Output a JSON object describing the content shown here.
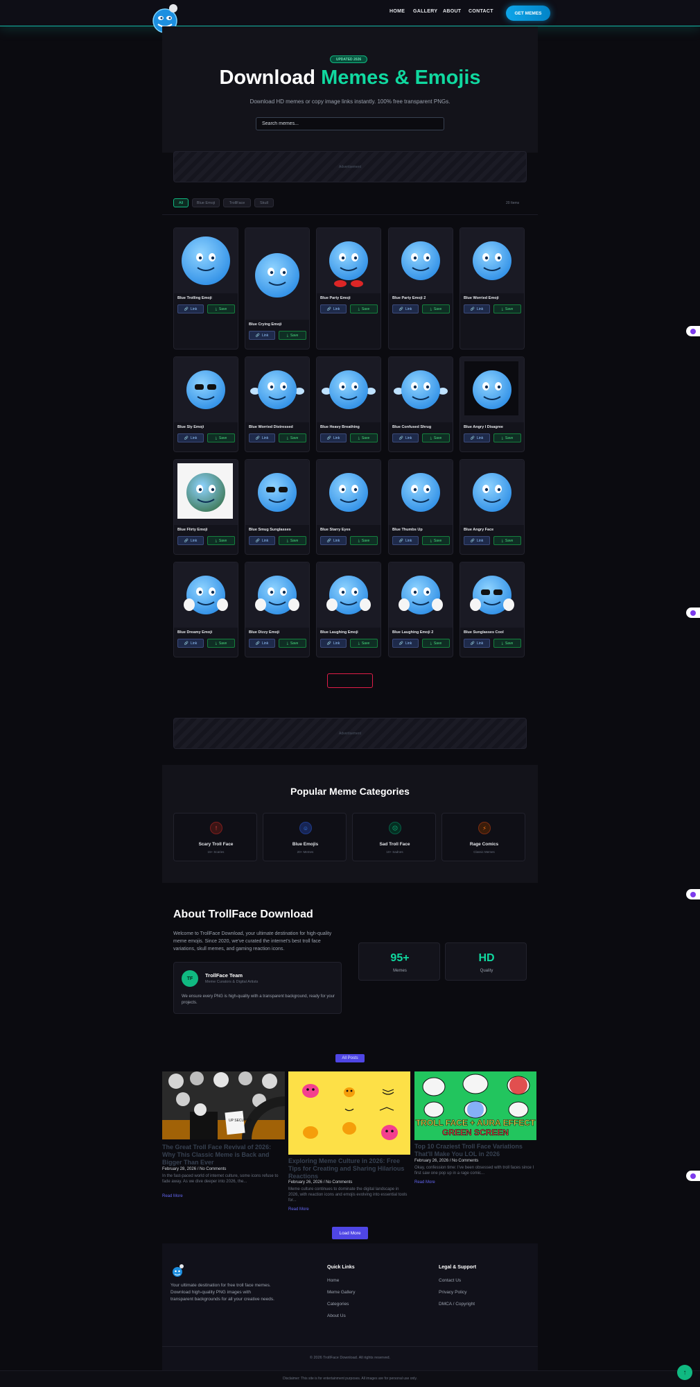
{
  "nav": {
    "items": [
      "HOME",
      "GALLERY",
      "ABOUT",
      "CONTACT"
    ],
    "cta": "GET MEMES"
  },
  "hero": {
    "badge": "UPDATED 2026",
    "title_main": "Download ",
    "title_accent": "Memes & Emojis",
    "subtitle": "Download HD memes or copy image links instantly. 100% free transparent PNGs.",
    "search_placeholder": "Search memes..."
  },
  "ads": {
    "label": "Advertisement"
  },
  "filters": {
    "chips": [
      "All",
      "Blue Emoji",
      "TrollFace",
      "Skull"
    ],
    "count": "20 Items"
  },
  "gallery": {
    "link_label": "Link",
    "save_label": "Save",
    "items": [
      "Blue Trolling Emoji",
      "Blue Crying Emoji",
      "Blue Party Emoji",
      "Blue Party Emoji 2",
      "Blue Worried Emoji",
      "Blue Sly Emoji",
      "Blue Worried Distressed",
      "Blue Heavy Breathing",
      "Blue Confused Shrug",
      "Blue Angry I Disagree",
      "Blue Flirty Emoji",
      "Blue Smug Sunglasses",
      "Blue Starry Eyes",
      "Blue Thumbs Up",
      "Blue Angry Face",
      "Blue Dreamy Emoji",
      "Blue Dizzy Emoji",
      "Blue Laughing Emoji",
      "Blue Laughing Emoji 2",
      "Blue Sunglasses Cool"
    ]
  },
  "categories": {
    "title": "Popular Meme Categories",
    "items": [
      {
        "name": "Scary Troll Face",
        "desc": "15+ Scaries",
        "color": "#ef4444"
      },
      {
        "name": "Blue Emojis",
        "desc": "20+ Memes",
        "color": "#3b82f6"
      },
      {
        "name": "Sad Troll Face",
        "desc": "10+ Sadnes",
        "color": "#10b981"
      },
      {
        "name": "Rage Comics",
        "desc": "Classic Memes",
        "color": "#f97316"
      }
    ]
  },
  "about": {
    "title": "About TrollFace Download",
    "text": "Welcome to TrollFace Download, your ultimate destination for high-quality meme emojis. Since 2020, we've curated the internet's best troll face variations, skull memes, and gaming reaction icons.",
    "team_initials": "TF",
    "team_name": "TrollFace Team",
    "team_role": "Meme Curators & Digital Artists",
    "team_quote": "We ensure every PNG is high-quality with a transparent background, ready for your projects.",
    "stats": [
      {
        "value": "95+",
        "label": "Memes"
      },
      {
        "value": "HD",
        "label": "Quality"
      }
    ]
  },
  "blog": {
    "all_posts": "All Posts",
    "read_more": "Read More",
    "load_more": "Load More",
    "posts": [
      {
        "title": "The Great Troll Face Revival of 2026: Why This Classic Meme is Back and Bigger Than Ever",
        "date": "February 28, 2026",
        "comments": "No Comments",
        "excerpt": "In the fast-paced world of internet culture, some icons refuse to fade away. As we dive deeper into 2026, the..."
      },
      {
        "title": "Exploring Meme Culture in 2026: Free Tips for Creating and Sharing Hilarious Reactions",
        "date": "February 26, 2026",
        "comments": "No Comments",
        "excerpt": "Meme culture continues to dominate the digital landscape in 2026, with reaction icons and emojis evolving into essential tools for..."
      },
      {
        "title": "Top 10 Craziest Troll Face Variations That'll Make You LOL in 2026",
        "date": "February 26, 2026",
        "comments": "No Comments",
        "excerpt": "Okay, confession time: I've been obsessed with troll faces since I first saw one pop up in a rage comic..."
      }
    ],
    "img3_caption_1": "TROLL FACE + AURA EFFECT",
    "img3_caption_2": "GREEN SCREEN",
    "img1_sign": "UP SECURED"
  },
  "footer": {
    "desc": "Your ultimate destination for free troll face memes. Download high-quality PNG images with transparent backgrounds for all your creative needs.",
    "quick_title": "Quick Links",
    "quick_links": [
      "Home",
      "Meme Gallery",
      "Categories",
      "About Us"
    ],
    "legal_title": "Legal & Support",
    "legal_links": [
      "Contact Us",
      "Privacy Policy",
      "DMCA / Copyright"
    ],
    "copyright": "© 2026 TrollFace Download. All rights reserved.",
    "disclaimer": "Disclaimer: This site is for entertainment purposes. All images are for personal use only."
  }
}
